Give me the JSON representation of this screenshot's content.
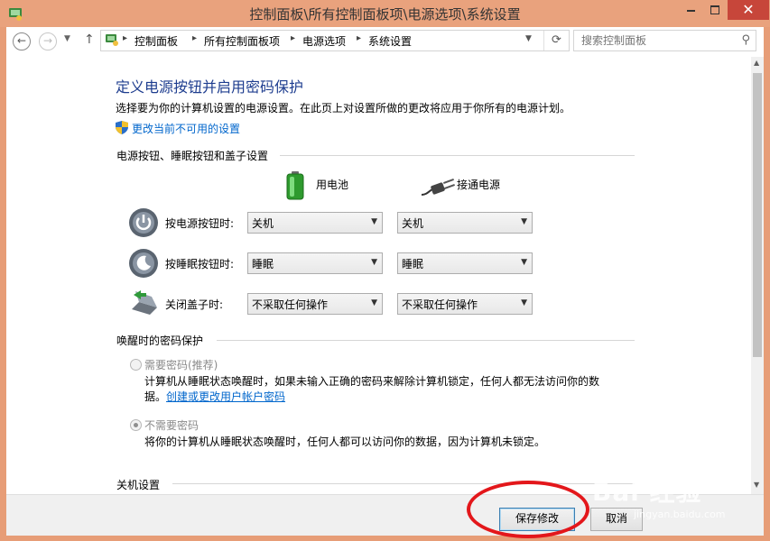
{
  "window": {
    "title": "控制面板\\所有控制面板项\\电源选项\\系统设置",
    "close_glyph": "✕"
  },
  "nav": {
    "back_glyph": "←",
    "forward_glyph": "→",
    "up_glyph": "↑",
    "breadcrumbs": [
      "控制面板",
      "所有控制面板项",
      "电源选项",
      "系统设置"
    ],
    "refresh_glyph": "⟳",
    "search_placeholder": "搜索控制面板"
  },
  "main": {
    "title": "定义电源按钮并启用密码保护",
    "description": "选择要为你的计算机设置的电源设置。在此页上对设置所做的更改将应用于你所有的电源计划。",
    "change_settings_link": "更改当前不可用的设置",
    "buttons_section": {
      "header": "电源按钮、睡眠按钮和盖子设置",
      "column_battery": "用电池",
      "column_plugged": "接通电源",
      "rows": [
        {
          "label": "按电源按钮时:",
          "battery": "关机",
          "plugged": "关机"
        },
        {
          "label": "按睡眠按钮时:",
          "battery": "睡眠",
          "plugged": "睡眠"
        },
        {
          "label": "关闭盖子时:",
          "battery": "不采取任何操作",
          "plugged": "不采取任何操作"
        }
      ]
    },
    "password_section": {
      "header": "唤醒时的密码保护",
      "require_label": "需要密码(推荐)",
      "require_desc": "计算机从睡眠状态唤醒时，如果未输入正确的密码来解除计算机锁定，任何人都无法访问你的数",
      "require_desc2_prefix": "据。",
      "require_link": "创建或更改用户帐户密码",
      "no_require_label": "不需要密码",
      "no_require_desc": "将你的计算机从睡眠状态唤醒时，任何人都可以访问你的数据，因为计算机未锁定。",
      "selected": "不需要密码"
    },
    "shutdown_section": {
      "header": "关机设置"
    }
  },
  "footer": {
    "save_label": "保存修改",
    "cancel_label": "取消"
  },
  "watermark": {
    "main": "Bai 经验",
    "sub": "jingyan.baidu.com"
  },
  "colors": {
    "title_blue": "#1e3d8f",
    "link_blue": "#0066cc",
    "frame_orange": "#e79d77",
    "annotation_red": "#e3171b"
  }
}
